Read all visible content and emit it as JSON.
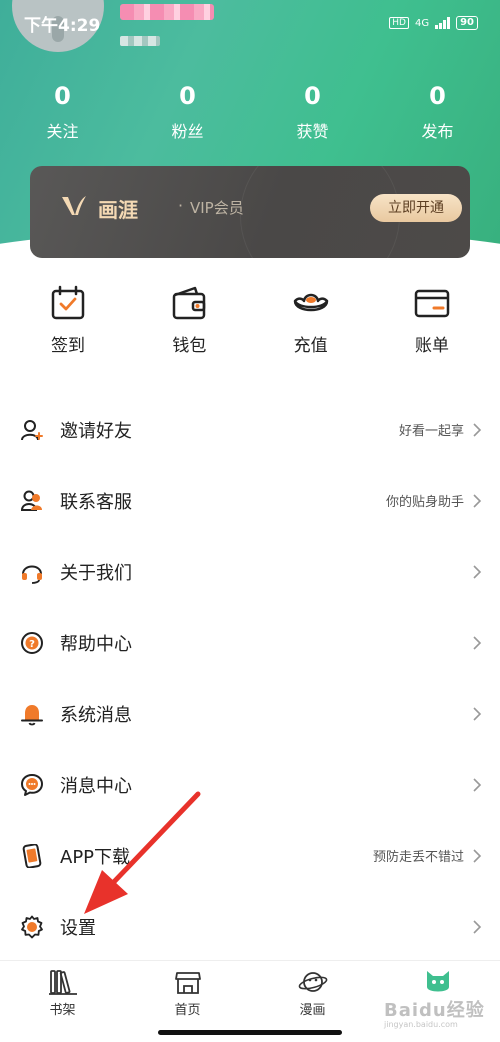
{
  "status_bar": {
    "time": "下午4:29",
    "hd": "HD",
    "network": "4G",
    "battery": "90"
  },
  "stats": [
    {
      "value": "0",
      "label": "关注"
    },
    {
      "value": "0",
      "label": "粉丝"
    },
    {
      "value": "0",
      "label": "获赞"
    },
    {
      "value": "0",
      "label": "发布"
    }
  ],
  "vip": {
    "brand": "画涯",
    "dot": "·",
    "subtitle": "VIP会员",
    "button": "立即开通",
    "accent": "#f4d9b4"
  },
  "actions": [
    {
      "label": "签到",
      "icon": "calendar-check-icon"
    },
    {
      "label": "钱包",
      "icon": "wallet-icon"
    },
    {
      "label": "充值",
      "icon": "gold-ingot-icon"
    },
    {
      "label": "账单",
      "icon": "bill-card-icon"
    }
  ],
  "menu": [
    {
      "label": "邀请好友",
      "hint": "好看一起享",
      "icon": "invite-friend-icon"
    },
    {
      "label": "联系客服",
      "hint": "你的贴身助手",
      "icon": "customer-service-icon"
    },
    {
      "label": "关于我们",
      "hint": "",
      "icon": "headset-icon"
    },
    {
      "label": "帮助中心",
      "hint": "",
      "icon": "help-icon"
    },
    {
      "label": "系统消息",
      "hint": "",
      "icon": "bell-icon"
    },
    {
      "label": "消息中心",
      "hint": "",
      "icon": "chat-bubble-icon"
    },
    {
      "label": "APP下载",
      "hint": "预防走丢不错过",
      "icon": "phone-download-icon"
    },
    {
      "label": "设置",
      "hint": "",
      "icon": "gear-icon"
    }
  ],
  "tabs": [
    {
      "label": "书架",
      "icon": "bookshelf-icon"
    },
    {
      "label": "首页",
      "icon": "storefront-icon"
    },
    {
      "label": "漫画",
      "icon": "planet-icon"
    },
    {
      "label": "",
      "icon": "cat-mascot-icon"
    }
  ],
  "watermark": {
    "text": "Baidu经验",
    "sub": "jingyan.baidu.com"
  },
  "colors": {
    "header": "#3fae9a",
    "orange": "#f07a2a",
    "annotation_arrow": "#e8322b"
  }
}
